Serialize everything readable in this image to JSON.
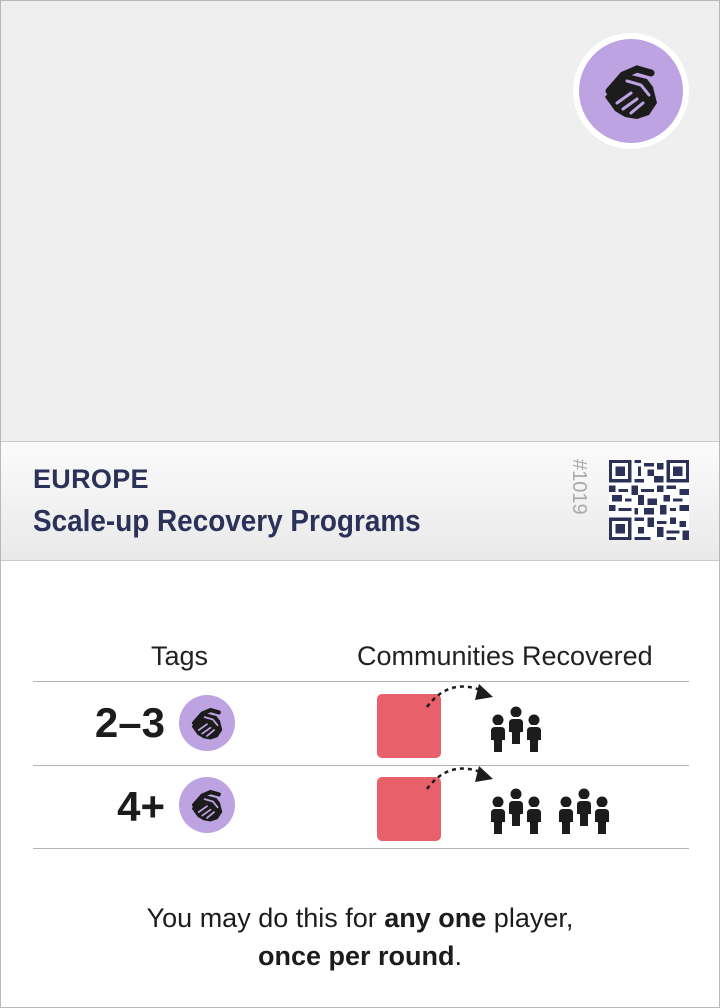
{
  "card": {
    "region": "EUROPE",
    "title": "Scale-up Recovery Programs",
    "number": "#1019",
    "badge_icon": "handshake-icon",
    "colors": {
      "accent": "#bea3e3",
      "title": "#2b3158",
      "cube": "#e8606a",
      "art_bg": "#efefef"
    }
  },
  "table": {
    "header_tags": "Tags",
    "header_communities": "Communities Recovered",
    "rows": [
      {
        "count": "2–3",
        "tag_icon": "handshake-icon",
        "communities_groups": 1
      },
      {
        "count": "4+",
        "tag_icon": "handshake-icon",
        "communities_groups": 2
      }
    ]
  },
  "footer": {
    "t1": "You may do this for ",
    "b1": "any one",
    "t2": " player,",
    "b2": "once per round",
    "t3": "."
  }
}
